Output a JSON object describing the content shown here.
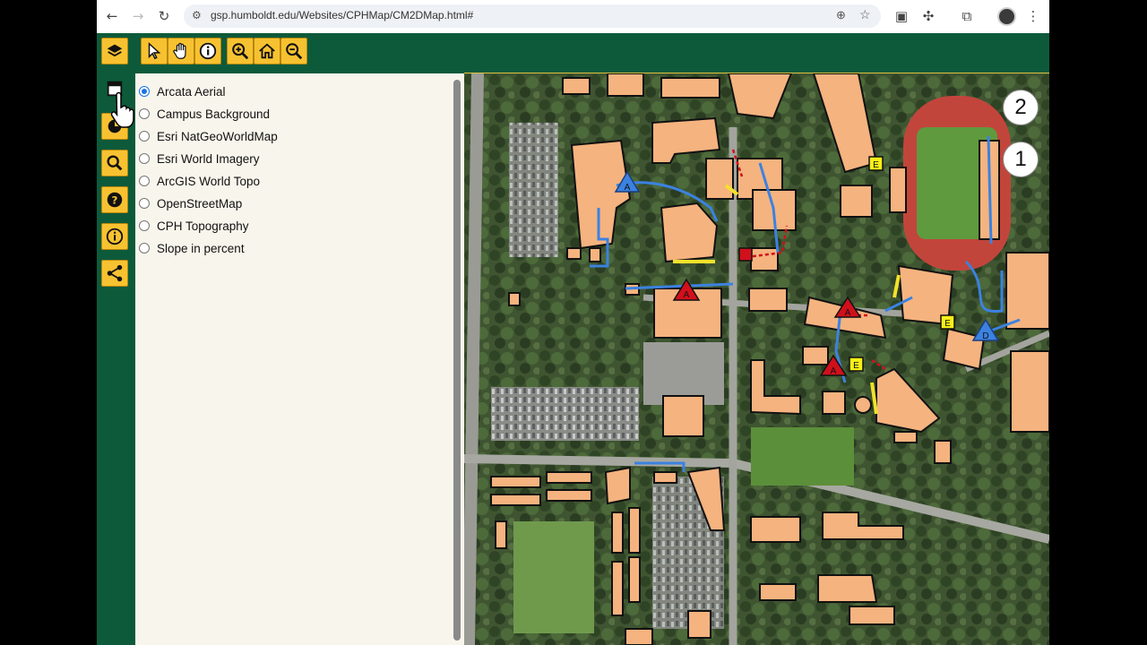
{
  "browser": {
    "url": "gsp.humboldt.edu/Websites/CPHMap/CM2DMap.html#",
    "icons": [
      "back-icon",
      "forward-icon",
      "reload-icon",
      "site-info-icon",
      "zoom-icon",
      "star-icon",
      "extension-icon",
      "puzzle-icon",
      "cast-icon",
      "profile-icon",
      "menu-icon"
    ]
  },
  "toolbar": {
    "tools": [
      "select-icon",
      "pan-hand-icon",
      "identify-info-icon",
      "zoom-in-icon",
      "home-icon",
      "zoom-out-icon"
    ]
  },
  "sidebar": {
    "tools": [
      "layers-icon",
      "basemap-icon",
      "legend-icon",
      "search-icon",
      "help-icon",
      "info-icon",
      "share-icon"
    ]
  },
  "basemaps": {
    "selected": "Arcata Aerial",
    "options": [
      "Arcata Aerial",
      "Campus Background",
      "Esri NatGeoWorldMap",
      "Esri World Imagery",
      "ArcGIS World Topo",
      "OpenStreetMap",
      "CPH Topography",
      "Slope in percent"
    ]
  },
  "map": {
    "badges": [
      "2",
      "1"
    ],
    "markers": {
      "blue": [
        "A",
        "D"
      ],
      "red": [
        "A",
        "A",
        "A"
      ],
      "yellow": [
        "E",
        "E",
        "E"
      ]
    },
    "colors": {
      "building": "#f5b37f",
      "route_blue": "#3b82e0",
      "route_yellow": "#f2e12b",
      "route_red": "#d1101b",
      "track": "#c2453c",
      "field": "#5c8f3a"
    }
  }
}
